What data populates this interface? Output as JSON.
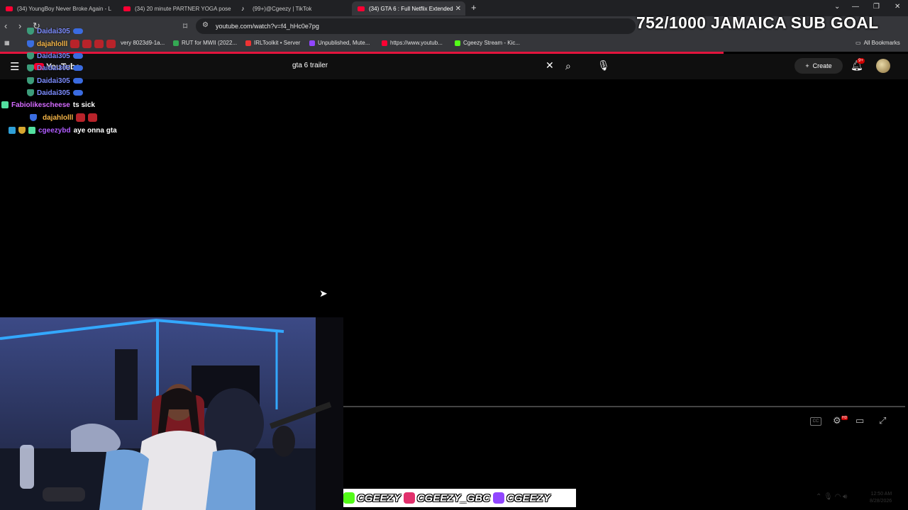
{
  "tabs": [
    {
      "label": "(34) YoungBoy Never Broke Again - L",
      "icon": "youtube-favicon"
    },
    {
      "label": "(34) 20 minute PARTNER YOGA pose",
      "icon": "youtube-favicon"
    },
    {
      "label": "(99+)@Cgeezy | TikTok",
      "icon": "tiktok-favicon"
    },
    {
      "label": "(34) GTA 6 : Full Netflix Extended",
      "icon": "youtube-favicon",
      "active": true
    }
  ],
  "address_bar": {
    "url": "youtube.com/watch?v=f4_hHc0e7pg"
  },
  "bookmarks": [
    {
      "label": "very 8023d9-1a..."
    },
    {
      "label": "RUT for MWII (2022..."
    },
    {
      "label": "IRLToolkit • Server"
    },
    {
      "label": "Unpublished, Mute..."
    },
    {
      "label": "https://www.youtub..."
    },
    {
      "label": "Cgeezy Stream - Kic..."
    }
  ],
  "all_bookmarks_label": "All Bookmarks",
  "youtube": {
    "logo_text": "YouTube",
    "search_value": "gta 6 trailer",
    "create_label": "Create",
    "notification_count": "9+"
  },
  "sub_goal_text": "752/1000 JAMAICA SUB GOAL",
  "chat": [
    {
      "user": "Daidai305",
      "color": "#7c8cff",
      "message": ""
    },
    {
      "user": "dajahlolll",
      "color": "#f5b547",
      "message": ""
    },
    {
      "user": "Daidai305",
      "color": "#7c8cff",
      "message": ""
    },
    {
      "user": "Daidai305",
      "color": "#7c8cff",
      "message": ""
    },
    {
      "user": "Daidai305",
      "color": "#7c8cff",
      "message": ""
    },
    {
      "user": "Daidai305",
      "color": "#7c8cff",
      "message": ""
    },
    {
      "user": "Fabiolikescheese",
      "color": "#d46bff",
      "message": "ts sick"
    },
    {
      "user": "dajahlolll",
      "color": "#f5b547",
      "message": ""
    },
    {
      "user": "cgeezybd",
      "color": "#b05cff",
      "message": "aye onna gta"
    }
  ],
  "socials": [
    {
      "handle": "CGEEZY",
      "platform": "kick",
      "color": "#53fc18"
    },
    {
      "handle": "CGEEZY_GBC",
      "platform": "instagram",
      "color": "#e1306c"
    },
    {
      "handle": "CGEEZY",
      "platform": "twitch",
      "color": "#9146ff"
    }
  ],
  "clock": {
    "time": "12:50 AM",
    "date": "8/28/2026"
  }
}
